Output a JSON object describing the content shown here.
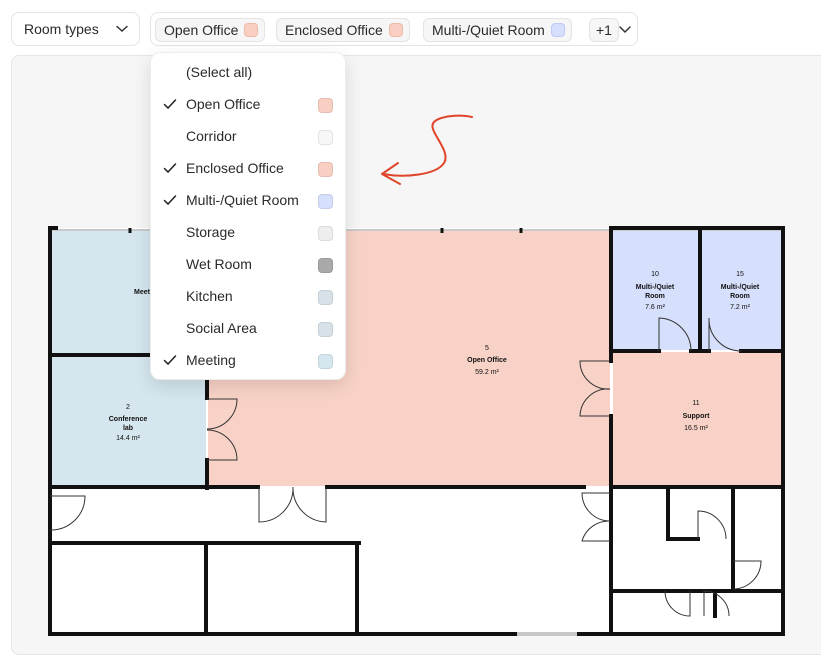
{
  "toolbar": {
    "room_types_label": "Room types",
    "chips": [
      {
        "label": "Open Office",
        "color": "#f8cfc2"
      },
      {
        "label": "Enclosed Office",
        "color": "#f8cfc2"
      },
      {
        "label": "Multi-/Quiet Room",
        "color": "#d6dffb"
      }
    ],
    "more_label": "+1"
  },
  "menu": {
    "items": [
      {
        "label": "(Select all)",
        "checked": false,
        "color": ""
      },
      {
        "label": "Open Office",
        "checked": true,
        "color": "#f8cfc2"
      },
      {
        "label": "Corridor",
        "checked": false,
        "color": "#f7f7f7"
      },
      {
        "label": "Enclosed Office",
        "checked": true,
        "color": "#f8cfc2"
      },
      {
        "label": "Multi-/Quiet Room",
        "checked": true,
        "color": "#d6dffb"
      },
      {
        "label": "Storage",
        "checked": false,
        "color": "#eeeeee"
      },
      {
        "label": "Wet Room",
        "checked": false,
        "color": "#a9a9a9"
      },
      {
        "label": "Kitchen",
        "checked": false,
        "color": "#d7e1e7"
      },
      {
        "label": "Social Area",
        "checked": false,
        "color": "#d7e1e7"
      },
      {
        "label": "Meeting",
        "checked": true,
        "color": "#d6e6ee"
      }
    ]
  },
  "rooms": [
    {
      "number": "",
      "name": "Meeting",
      "name_visible": "Meet",
      "area": ""
    },
    {
      "number": "2",
      "name": "Conference",
      "name2": "lab",
      "area": "14.4 m²"
    },
    {
      "number": "5",
      "name": "Open Office",
      "area": "59.2 m²"
    },
    {
      "number": "10",
      "name": "Multi-/Quiet",
      "name2": "Room",
      "area": "7.6 m²"
    },
    {
      "number": "15",
      "name": "Multi-/Quiet",
      "name2": "Room",
      "area": "7.2 m²"
    },
    {
      "number": "11",
      "name": "Support",
      "area": "16.5 m²"
    }
  ],
  "colors": {
    "open_office": "#f8d2c6",
    "meeting": "#d5e6ee",
    "quiet": "#d6dffb",
    "wall": "#111111",
    "annotation": "#e0452b"
  }
}
